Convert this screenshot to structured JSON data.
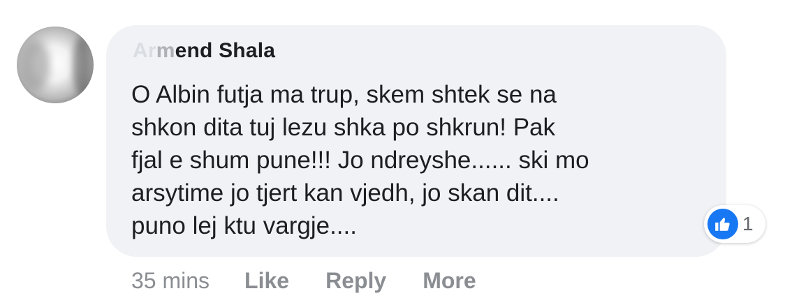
{
  "comment": {
    "author": {
      "name_faded": "Ar",
      "name_faded2": "m",
      "name_rest": "end Shala"
    },
    "lines": [
      "O Albin futja ma trup, skem shtek se na",
      "shkon dita tuj lezu shka po shkrun! Pak",
      "fjal e shum pune!!! Jo ndreyshe...... ski mo",
      "arsytime jo tjert kan vjedh, jo skan dit....",
      "puno lej ktu vargje...."
    ],
    "reactions": {
      "icon": "thumbs-up-icon",
      "count": "1",
      "color": "#1877f2"
    },
    "actions": {
      "timestamp": "35 mins",
      "like_label": "Like",
      "reply_label": "Reply",
      "more_label": "More"
    }
  },
  "colors": {
    "bubble": "#f0f2f5",
    "text": "#1c1e21",
    "meta": "#8a8d91"
  }
}
